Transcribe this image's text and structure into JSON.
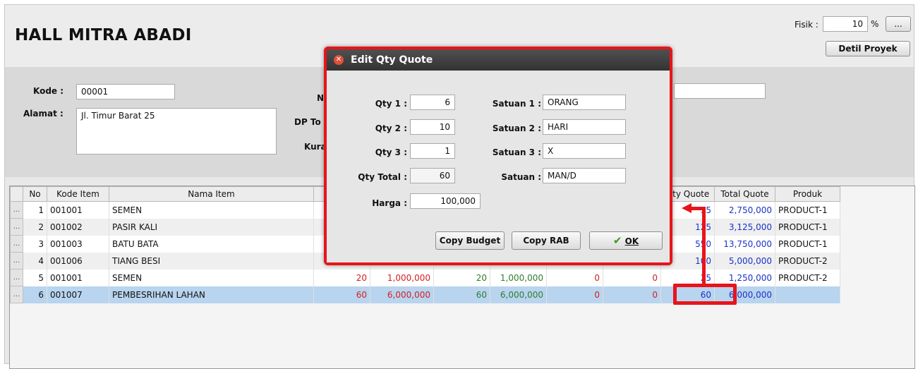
{
  "header": {
    "title": "HALL MITRA ABADI",
    "fisik_label": "Fisik :",
    "fisik_value": "10",
    "fisik_unit": "%",
    "ellipsis_label": "...",
    "detil_button": "Detil Proyek"
  },
  "info": {
    "kode_label": "Kode :",
    "kode_value": "00001",
    "alamat_label": "Alamat :",
    "alamat_value": "Jl. Timur Barat 25",
    "n_label_partial": "N",
    "dp_label_partial": "DP To",
    "kura_label_partial": "Kura"
  },
  "grid": {
    "columns": {
      "no": "No",
      "kode": "Kode Item",
      "nama": "Nama Item",
      "qty_quote": "Qty Quote",
      "total_quote": "Total Quote",
      "produk": "Produk"
    },
    "rows": [
      {
        "dots": "...",
        "no": "1",
        "kode": "001001",
        "nama": "SEMEN",
        "qty_quote": "55",
        "total_quote": "2,750,000",
        "produk": "PRODUCT-1"
      },
      {
        "dots": "...",
        "no": "2",
        "kode": "001002",
        "nama": "PASIR KALI",
        "qty_quote": "125",
        "total_quote": "3,125,000",
        "produk": "PRODUCT-1"
      },
      {
        "dots": "...",
        "no": "3",
        "kode": "001003",
        "nama": "BATU BATA",
        "qty_quote": "550",
        "total_quote": "13,750,000",
        "produk": "PRODUCT-1"
      },
      {
        "dots": "...",
        "no": "4",
        "kode": "001006",
        "nama": "TIANG BESI",
        "qty_quote": "100",
        "total_quote": "5,000,000",
        "produk": "PRODUCT-2"
      },
      {
        "dots": "...",
        "no": "5",
        "kode": "001001",
        "nama": "SEMEN",
        "c1": "20",
        "c2": "1,000,000",
        "c3": "20",
        "c4": "1,000,000",
        "c5": "0",
        "c6": "0",
        "qty_quote": "25",
        "total_quote": "1,250,000",
        "produk": "PRODUCT-2"
      },
      {
        "dots": "...",
        "no": "6",
        "kode": "001007",
        "nama": "PEMBESRIHAN LAHAN",
        "c1": "60",
        "c2": "6,000,000",
        "c3": "60",
        "c4": "6,000,000",
        "c5": "0",
        "c6": "0",
        "qty_quote": "60",
        "total_quote": "6,000,000",
        "produk": ""
      }
    ]
  },
  "dialog": {
    "title": "Edit Qty Quote",
    "qty1_label": "Qty 1 :",
    "qty1_value": "6",
    "qty2_label": "Qty 2 :",
    "qty2_value": "10",
    "qty3_label": "Qty 3 :",
    "qty3_value": "1",
    "qty_total_label": "Qty Total :",
    "qty_total_value": "60",
    "harga_label": "Harga :",
    "harga_value": "100,000",
    "satuan1_label": "Satuan 1 :",
    "satuan1_value": "ORANG",
    "satuan2_label": "Satuan 2 :",
    "satuan2_value": "HARI",
    "satuan3_label": "Satuan 3 :",
    "satuan3_value": "X",
    "satuan_label": "Satuan :",
    "satuan_value": "MAN/D",
    "copy_budget": "Copy Budget",
    "copy_rab": "Copy RAB",
    "ok": "OK"
  },
  "colors": {
    "highlight": "#e8141a",
    "selected_row": "#b8d4ef"
  }
}
